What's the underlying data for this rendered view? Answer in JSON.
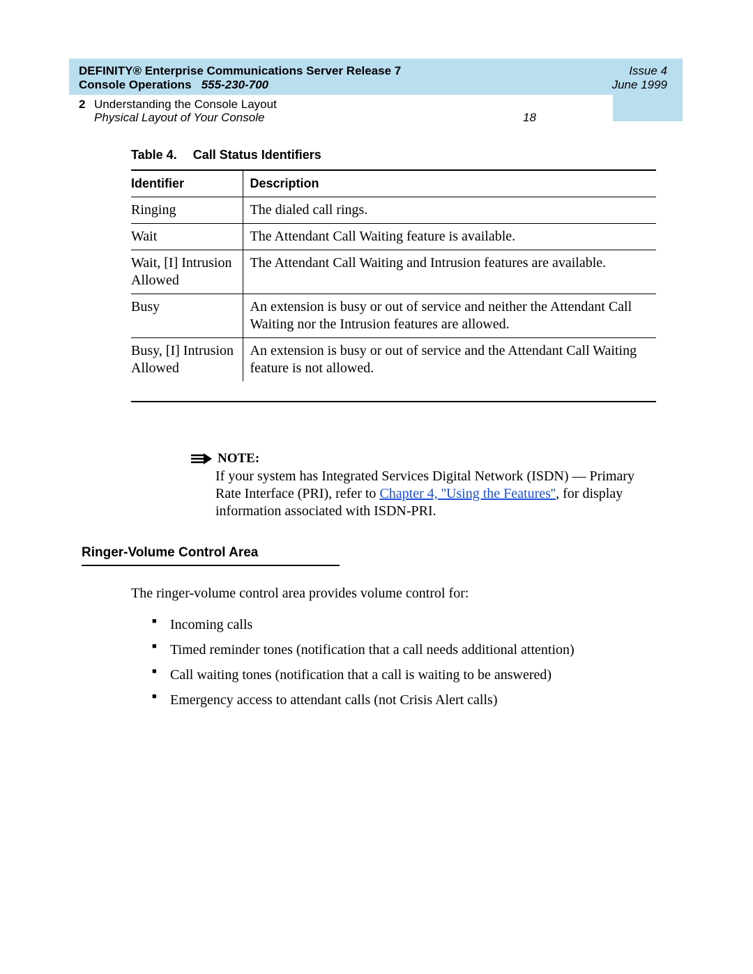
{
  "header": {
    "title_line1": "DEFINITY® Enterprise Communications Server Release 7",
    "title_line2a": "Console Operations",
    "title_line2b": "555-230-700",
    "issue": "Issue 4",
    "date": "June 1999",
    "chapter_num": "2",
    "chapter_title": "Understanding the Console Layout",
    "subchapter": "Physical Layout of Your Console",
    "page": "18"
  },
  "table": {
    "caption_label": "Table 4.",
    "caption_title": "Call Status Identifiers",
    "col1": "Identifier",
    "col2": "Description",
    "rows": [
      {
        "id": "Ringing",
        "desc": "The dialed call rings."
      },
      {
        "id": "Wait",
        "desc": "The Attendant Call Waiting feature is available."
      },
      {
        "id": "Wait, [I] Intrusion Allowed",
        "desc": "The Attendant Call Waiting and Intrusion features are available."
      },
      {
        "id": "Busy",
        "desc": "An extension is busy or out of service and neither the Attendant Call Waiting nor the Intrusion features are allowed."
      },
      {
        "id": "Busy, [I] Intrusion Allowed",
        "desc": "An extension is busy or out of service and the Attendant Call Waiting feature is not allowed."
      }
    ]
  },
  "note": {
    "label": "NOTE:",
    "text_before": "If your system has Integrated Services Digital Network (ISDN) — Primary Rate Interface (PRI), refer to ",
    "link": "Chapter 4, ''Using the Features''",
    "text_after": ", for display information associated with ISDN-PRI."
  },
  "section": {
    "heading": "Ringer-Volume Control Area",
    "intro": "The ringer-volume control area provides volume control for:",
    "bullets": [
      "Incoming calls",
      "Timed reminder tones (notification that a call needs additional attention)",
      "Call waiting tones (notification that a call is waiting to be answered)",
      "Emergency access to attendant calls (not Crisis Alert calls)"
    ]
  }
}
